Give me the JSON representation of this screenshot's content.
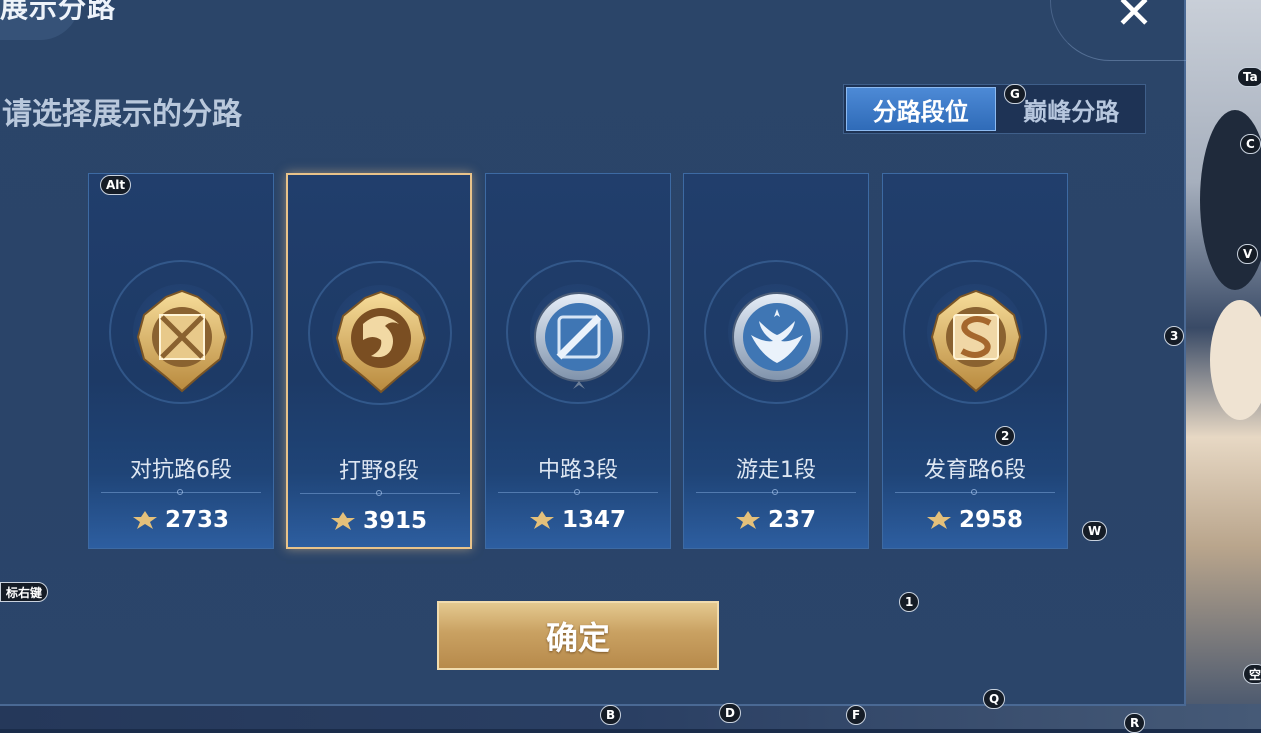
{
  "title": "展示分路",
  "close_label": "✕",
  "subtitle": "请选择展示的分路",
  "segment": {
    "options": [
      {
        "label": "分路段位",
        "active": true
      },
      {
        "label": "巅峰分路",
        "active": false
      }
    ]
  },
  "lanes": [
    {
      "label": "对抗路6段",
      "score": "2733",
      "tier": "gold",
      "icon": "crossed-swords-emblem",
      "selected": false
    },
    {
      "label": "打野8段",
      "score": "3915",
      "tier": "gold",
      "icon": "dragon-emblem",
      "selected": true
    },
    {
      "label": "中路3段",
      "score": "1347",
      "tier": "silver",
      "icon": "staff-emblem",
      "selected": false
    },
    {
      "label": "游走1段",
      "score": "237",
      "tier": "silver",
      "icon": "wings-emblem",
      "selected": false
    },
    {
      "label": "发育路6段",
      "score": "2958",
      "tier": "gold",
      "icon": "s-sigil-emblem",
      "selected": false
    }
  ],
  "confirm_label": "确定",
  "colors": {
    "gold": "#d9b46c",
    "silver": "#a9c7e6",
    "panel": "#2b4569",
    "accent_blue": "#3f7cc8"
  },
  "hotkeys": [
    {
      "key": "Alt",
      "name": "hotkey-alt"
    },
    {
      "key": "G",
      "name": "hotkey-g"
    },
    {
      "key": "3",
      "name": "hotkey-3"
    },
    {
      "key": "2",
      "name": "hotkey-2"
    },
    {
      "key": "W",
      "name": "hotkey-w"
    },
    {
      "key": "1",
      "name": "hotkey-1"
    },
    {
      "key": "Q",
      "name": "hotkey-q"
    },
    {
      "key": "B",
      "name": "hotkey-b"
    },
    {
      "key": "D",
      "name": "hotkey-d"
    },
    {
      "key": "F",
      "name": "hotkey-f"
    },
    {
      "key": "R",
      "name": "hotkey-r"
    },
    {
      "key": "Ta",
      "name": "hotkey-tab"
    },
    {
      "key": "C",
      "name": "hotkey-c"
    },
    {
      "key": "V",
      "name": "hotkey-v"
    },
    {
      "key": "空",
      "name": "hotkey-space"
    },
    {
      "key": "标右键",
      "name": "hotkey-right-click"
    }
  ]
}
